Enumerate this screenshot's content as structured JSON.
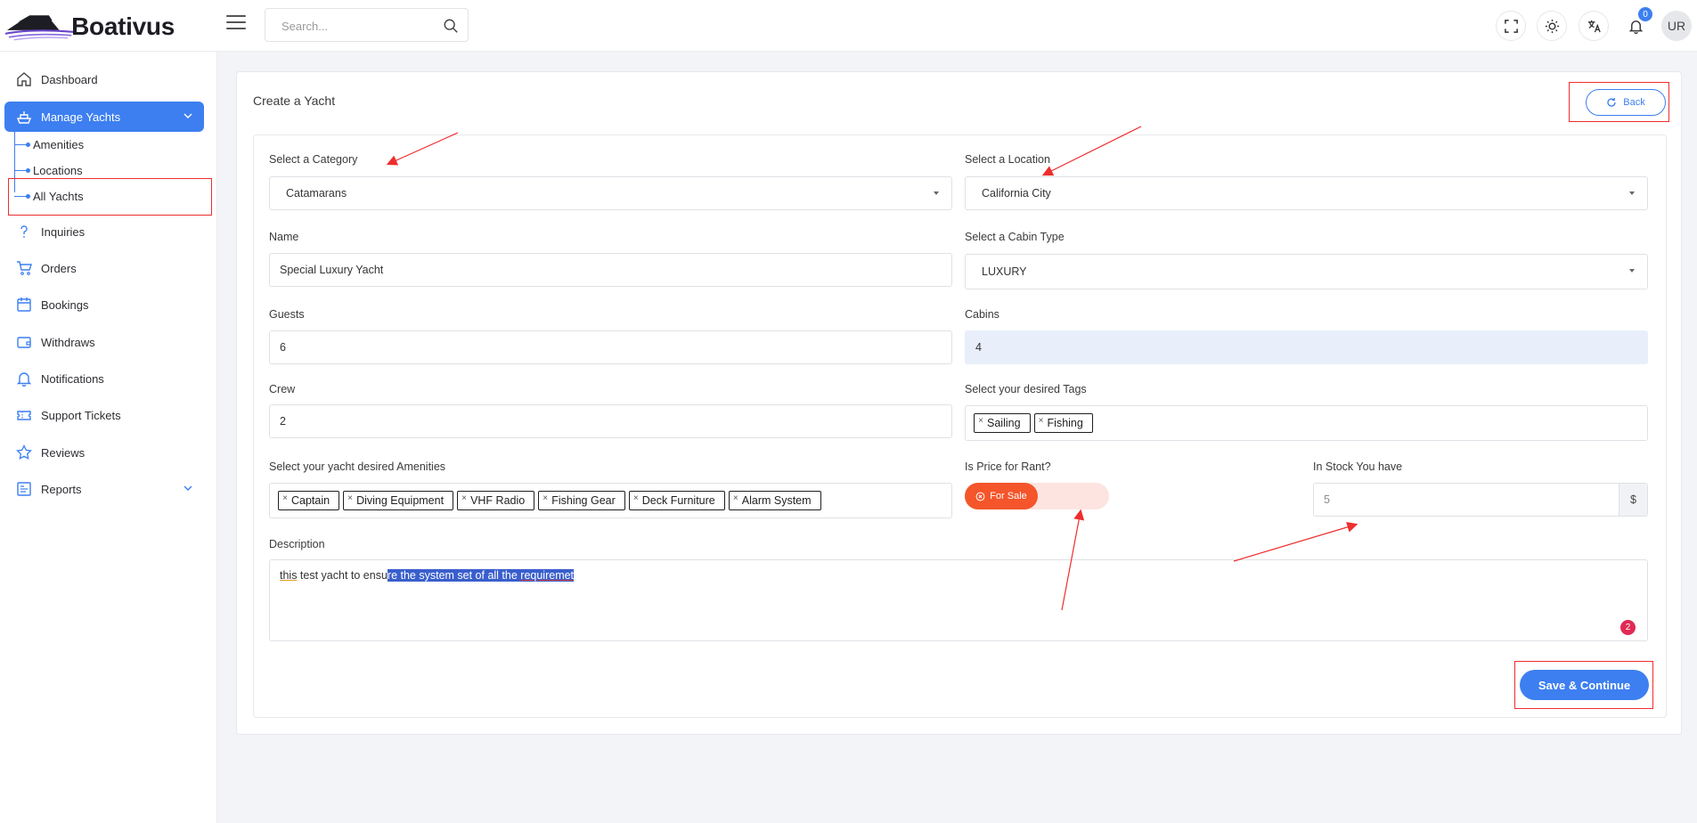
{
  "brand": {
    "name": "Boativus"
  },
  "header": {
    "search_placeholder": "Search...",
    "notification_count": "0",
    "user_initials": "UR"
  },
  "sidebar": {
    "items": [
      {
        "label": "Dashboard",
        "icon": "home-icon"
      },
      {
        "label": "Manage Yachts",
        "icon": "yacht-icon",
        "active": true
      },
      {
        "label": "Inquiries",
        "icon": "question-icon"
      },
      {
        "label": "Orders",
        "icon": "cart-icon"
      },
      {
        "label": "Bookings",
        "icon": "calendar-icon"
      },
      {
        "label": "Withdraws",
        "icon": "wallet-icon"
      },
      {
        "label": "Notifications",
        "icon": "bell-icon"
      },
      {
        "label": "Support Tickets",
        "icon": "ticket-icon"
      },
      {
        "label": "Reviews",
        "icon": "star-icon"
      },
      {
        "label": "Reports",
        "icon": "report-icon"
      }
    ],
    "subitems": [
      {
        "label": "Amenities"
      },
      {
        "label": "Locations"
      },
      {
        "label": "All Yachts"
      }
    ]
  },
  "form": {
    "title": "Create a Yacht",
    "back_label": "Back",
    "category": {
      "label": "Select a Category",
      "value": "Catamarans"
    },
    "location": {
      "label": "Select a Location",
      "value": "California City"
    },
    "name": {
      "label": "Name",
      "value": "Special Luxury Yacht"
    },
    "cabin_type": {
      "label": "Select a Cabin Type",
      "value": "LUXURY"
    },
    "guests": {
      "label": "Guests",
      "value": "6"
    },
    "cabins": {
      "label": "Cabins",
      "value": "4"
    },
    "crew": {
      "label": "Crew",
      "value": "2"
    },
    "tags": {
      "label": "Select your desired Tags",
      "values": [
        "Sailing",
        "Fishing"
      ]
    },
    "amenities": {
      "label": "Select your yacht desired Amenities",
      "values": [
        "Captain",
        "Diving Equipment",
        "VHF Radio",
        "Fishing Gear",
        "Deck Furniture",
        "Alarm System"
      ]
    },
    "price": {
      "label": "Is Price for Rant?",
      "option": "For Sale"
    },
    "stock": {
      "label": "In Stock You have",
      "placeholder": "5",
      "suffix": "$"
    },
    "description": {
      "label": "Description",
      "word1": "this",
      "plain": " test yacht to ensu",
      "selected_a": "re the system set of all the ",
      "selected_b": "requiremet",
      "counter": "2"
    },
    "save_label": "Save & Continue"
  },
  "colors": {
    "primary": "#3d7ff0",
    "danger": "#f4552b",
    "annotation": "#ef2d2d"
  }
}
